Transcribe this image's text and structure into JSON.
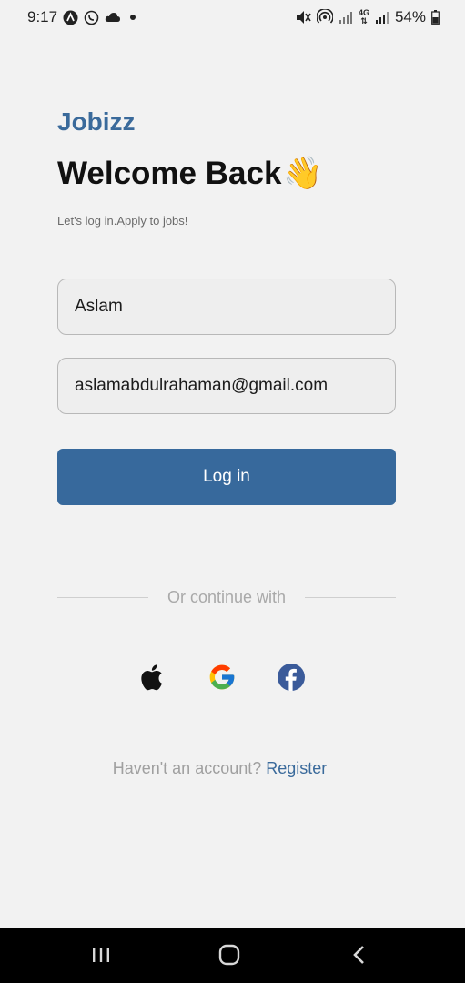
{
  "status_bar": {
    "time": "9:17",
    "battery": "54%",
    "network": "4G"
  },
  "login": {
    "brand": "Jobizz",
    "title": "Welcome Back",
    "wave_emoji": "👋",
    "subtitle": "Let's log in.Apply to jobs!",
    "name_value": "Aslam",
    "email_value": "aslamabdulrahaman@gmail.com",
    "login_label": "Log in",
    "divider_label": "Or continue with",
    "social": [
      "apple-icon",
      "google-icon",
      "facebook-icon"
    ],
    "no_account_text": "Haven't an account?",
    "register_label": "Register"
  },
  "colors": {
    "brand": "#3a6a9b",
    "button": "#37699c",
    "background": "#f2f2f2"
  }
}
